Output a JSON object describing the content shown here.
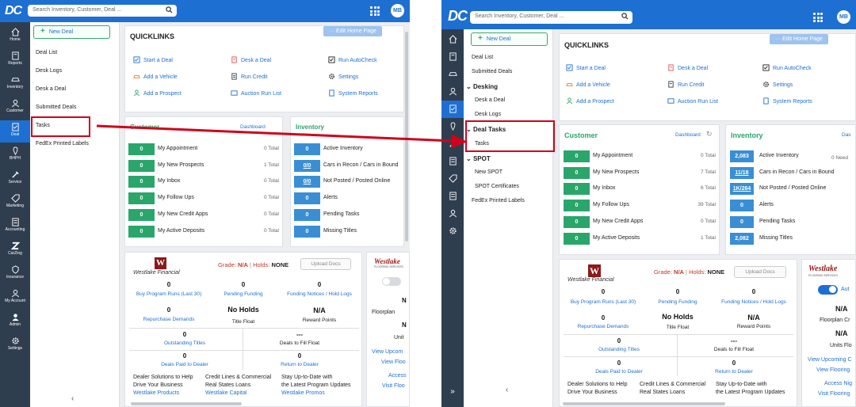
{
  "app": {
    "logo": "DC",
    "search_placeholder": "Search Inventory, Customer, Deal ...",
    "user_initials": "MB"
  },
  "rail": [
    "Home",
    "Reports",
    "Inventory",
    "Customer",
    "Deal",
    "BHPH",
    "Service",
    "Marketing",
    "Accounting",
    "CarZing",
    "Insurance",
    "My Account",
    "Admin",
    "Settings"
  ],
  "menu_left": {
    "new_deal": "New Deal",
    "items": [
      "Deal List",
      "Desk Logs",
      "Desk a Deal",
      "Submitted Deals",
      "Tasks",
      "FedEx Printed Labels"
    ]
  },
  "menu_right": {
    "new_deal": "New Deal",
    "items": [
      "Deal List",
      "Submitted Deals"
    ],
    "desking": "Desking",
    "desking_items": [
      "Desk a Deal",
      "Desk Logs"
    ],
    "deal_tasks": "Deal Tasks",
    "deal_tasks_items": [
      "Tasks"
    ],
    "spot": "SPOT",
    "spot_items": [
      "New SPOT",
      "SPOT Certificates"
    ],
    "fedex": "FedEx Printed Labels"
  },
  "quicklinks": {
    "title": "QUICKLINKS",
    "edit": "Edit Home Page",
    "links": [
      "Start a Deal",
      "Desk a Deal",
      "Run AutoCheck",
      "Add a Vehicle",
      "Run Credit",
      "Settings",
      "Add a Prospect",
      "Auction Run List",
      "System Reports"
    ]
  },
  "customer": {
    "title": "Customer",
    "dashboard": "Dashboard",
    "rows_left": [
      {
        "value": "0",
        "label": "My Appointment",
        "total": "0 Total"
      },
      {
        "value": "0",
        "label": "My New Prospects",
        "total": "1 Total"
      },
      {
        "value": "0",
        "label": "My Inbox",
        "total": "0 Total"
      },
      {
        "value": "0",
        "label": "My Follow Ups",
        "total": "0 Total"
      },
      {
        "value": "0",
        "label": "My New Credit Apps",
        "total": "0 Total"
      },
      {
        "value": "0",
        "label": "My Active Deposits",
        "total": "0 Total"
      }
    ],
    "rows_right": [
      {
        "value": "0",
        "label": "My Appointment",
        "total": "0 Total"
      },
      {
        "value": "0",
        "label": "My New Prospects",
        "total": "7 Total"
      },
      {
        "value": "0",
        "label": "My Inbox",
        "total": "6 Total"
      },
      {
        "value": "0",
        "label": "My Follow Ups",
        "total": "39 Total"
      },
      {
        "value": "0",
        "label": "My New Credit Apps",
        "total": "0 Total"
      },
      {
        "value": "0",
        "label": "My Active Deposits",
        "total": "1 Total"
      }
    ]
  },
  "inventory": {
    "title": "Inventory",
    "title_right_dash": "Das",
    "need": "0 Need",
    "rows_left": [
      {
        "value": "0",
        "label": "Active Inventory"
      },
      {
        "value": "0/0",
        "label": "Cars in Recon / Cars in Bound"
      },
      {
        "value": "0/0",
        "label": "Not Posted / Posted Online"
      },
      {
        "value": "0",
        "label": "Alerts"
      },
      {
        "value": "0",
        "label": "Pending Tasks"
      },
      {
        "value": "0",
        "label": "Missing Titles"
      }
    ],
    "rows_right": [
      {
        "value": "2,083",
        "label": "Active Inventory"
      },
      {
        "value": "11/18",
        "label": "Cars in Recon / Cars in Bound"
      },
      {
        "value": "1K/264",
        "label": "Not Posted / Posted Online"
      },
      {
        "value": "0",
        "label": "Alerts"
      },
      {
        "value": "0",
        "label": "Pending Tasks"
      },
      {
        "value": "2,082",
        "label": "Missing Titles"
      }
    ]
  },
  "westlake": {
    "brand": "Westlake Financial",
    "grade_label": "Grade:",
    "grade": "N/A",
    "holds_label": "Holds:",
    "holds": "NONE",
    "upload": "Upload Docs",
    "buy_runs": "0",
    "buy_runs_label": "Buy Program Runs (Last 30)",
    "pending": "0",
    "pending_label": "Pending Funding",
    "notices": "0",
    "notices_label": "Funding Notices / Hold Logs",
    "repurchase": "0",
    "repurchase_label": "Repurchase Demands",
    "title_float": "No Holds",
    "title_float_label": "Title Float",
    "reward": "N/A",
    "reward_label": "Reward Points",
    "outstanding": "0",
    "outstanding_label": "Outstanding Titles",
    "fill_float": "---",
    "fill_float_label": "Deals to Fill Float",
    "paid": "0",
    "paid_label": "Deals Paid to Dealer",
    "return": "0",
    "return_label": "Return to Dealer",
    "promo1_a": "Dealer Solutions to Help",
    "promo1_b": "Drive Your Business",
    "promo1_link": "Westlake Products",
    "promo2_a": "Credit Lines & Commercial",
    "promo2_b": "Real States Loans",
    "promo2_link": "Westlake Capital",
    "promo3_a": "Stay Up-to-Date with",
    "promo3_b": "the Latest Program Updates",
    "promo3_link": "Westlake Promos"
  },
  "flooring": {
    "brand": "Westlake",
    "brand_sub": "FLOORING SERVICES",
    "auto": "Aut",
    "na1": "N/A",
    "floorplan": "Floorplan Cr",
    "na2": "N/A",
    "units": "Units Flo",
    "view_upcoming": "View Upcoming C",
    "view_flooring": "View Flooring",
    "access": "Access Nig",
    "visit": "Visit Flooring",
    "left_n": "N",
    "left_floorplan": "Floorplan",
    "left_units": "Unit",
    "left_view_up": "View Upcom",
    "left_view_flo": "View Floo",
    "left_access": "Access",
    "left_visit": "Visit Floo"
  },
  "colors": {
    "primary": "#1e6fd2",
    "rail": "#2f3e4f",
    "green": "#2aa66b",
    "blue_box": "#3a8fd4",
    "highlight": "#d0021b"
  }
}
